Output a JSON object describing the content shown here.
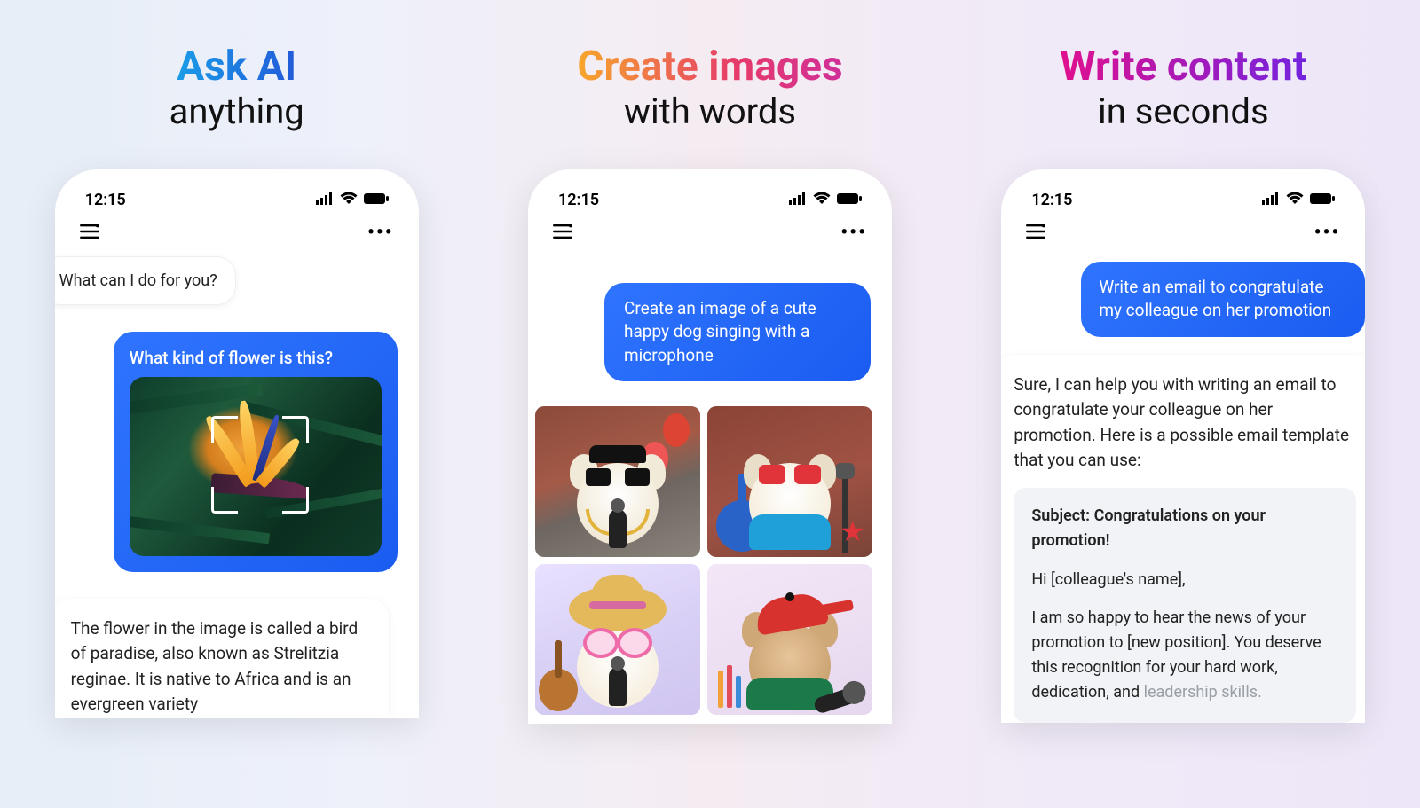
{
  "status": {
    "time": "12:15"
  },
  "panel1": {
    "headline_top": "Ask AI",
    "headline_bottom": "anything",
    "greeting": "What can I do for you?",
    "user_question": "What kind of flower is this?",
    "response": "The flower in the image is called a bird of paradise, also known as Strelitzia reginae. It is native to Africa and is an evergreen variety"
  },
  "panel2": {
    "headline_top": "Create images",
    "headline_bottom": "with words",
    "user_prompt": "Create an image of a cute happy dog singing with a microphone"
  },
  "panel3": {
    "headline_top": "Write content",
    "headline_bottom": "in seconds",
    "user_prompt": "Write an email to congratulate my colleague on her promotion",
    "response_intro": "Sure, I can help you with writing an email to congratulate your colleague on her promotion. Here is a possible email template that you can use:",
    "email": {
      "subject": "Subject: Congratulations on your promotion!",
      "greeting": "Hi [colleague's name],",
      "body1_a": "I am so happy to hear the news of your promotion to [new position]. You deserve this recognition for your hard work, dedication, and ",
      "body1_b": "leadership skills."
    }
  }
}
